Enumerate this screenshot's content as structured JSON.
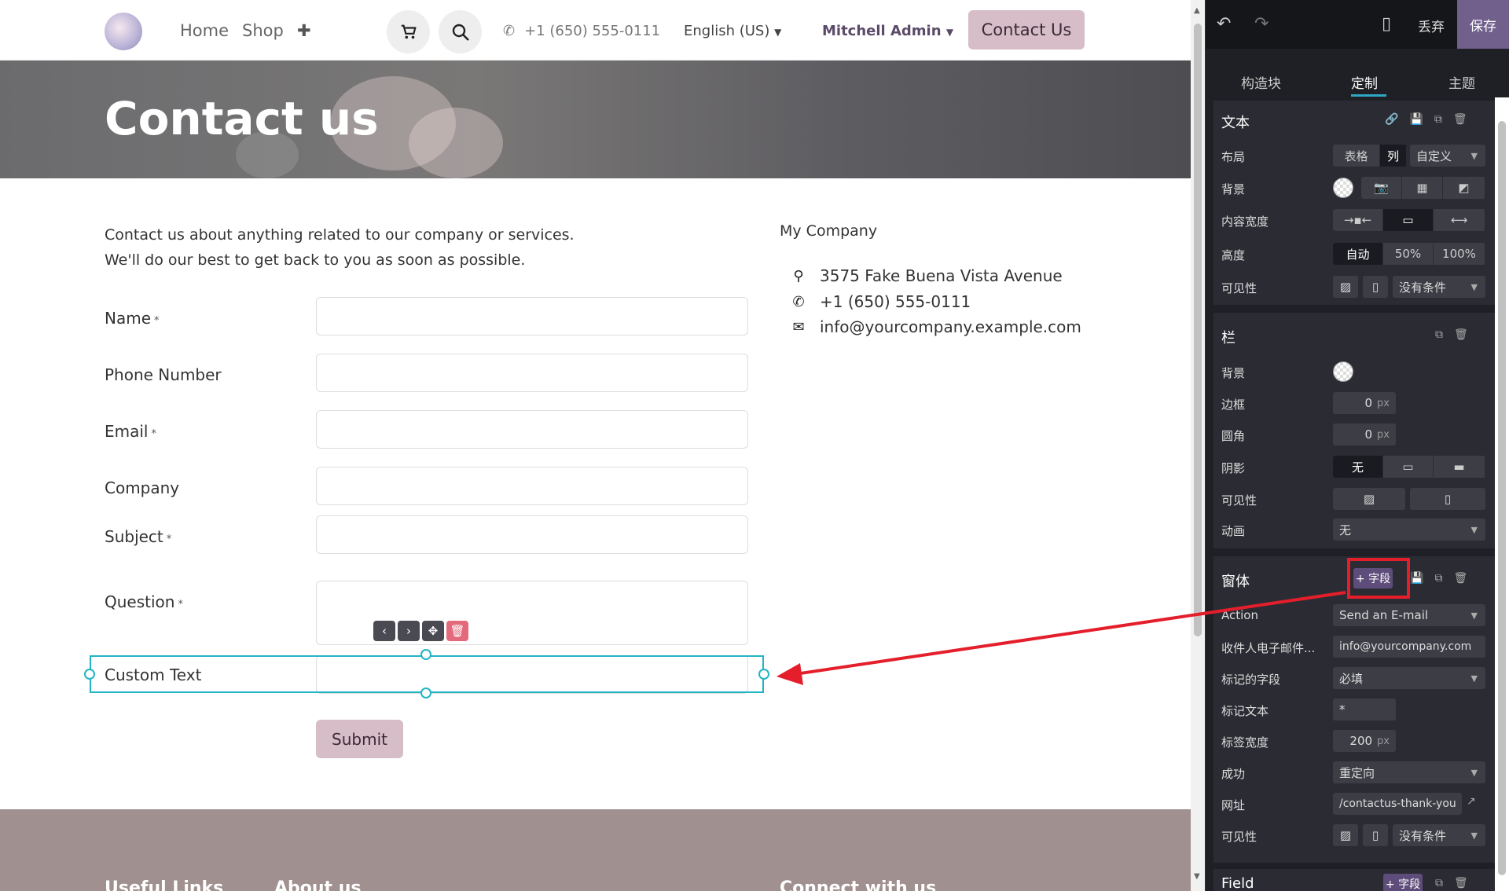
{
  "nav": {
    "home": "Home",
    "shop": "Shop",
    "plus": "✚",
    "phone": "+1 (650) 555-0111",
    "language": "English (US)",
    "admin": "Mitchell Admin",
    "contact_us": "Contact Us"
  },
  "banner": {
    "title": "Contact us"
  },
  "intro": {
    "line1": "Contact us about anything related to our company or services.",
    "line2": "We'll do our best to get back to you as soon as possible."
  },
  "company": {
    "name": "My Company",
    "address": "3575 Fake Buena Vista Avenue",
    "phone": "+1 (650) 555-0111",
    "email": "info@yourcompany.example.com"
  },
  "form": {
    "name": "Name",
    "phone": "Phone Number",
    "email": "Email",
    "company": "Company",
    "subject": "Subject",
    "question": "Question",
    "custom": "Custom Text",
    "required_mark": "*",
    "submit": "Submit"
  },
  "footer": {
    "useful_links": "Useful Links",
    "about": "About us",
    "connect": "Connect with us"
  },
  "panel": {
    "discard": "丢弃",
    "save": "保存",
    "tabs": [
      "构造块",
      "定制",
      "主题"
    ],
    "text_section": {
      "title": "文本",
      "layout": "布局",
      "layout_opts": [
        "表格",
        "列",
        "自定义"
      ],
      "background": "背景",
      "content_width": "内容宽度",
      "height": "高度",
      "height_opts": [
        "自动",
        "50%",
        "100%"
      ],
      "visibility": "可见性",
      "no_condition": "没有条件"
    },
    "column_section": {
      "title": "栏",
      "background": "背景",
      "border": "边框",
      "border_val": "0",
      "radius": "圆角",
      "radius_val": "0",
      "unit": "px",
      "shadow": "阴影",
      "shadow_none": "无",
      "visibility": "可见性",
      "animation": "动画",
      "animation_val": "无"
    },
    "form_section": {
      "title": "窗体",
      "add_field": "+ 字段",
      "action": "Action",
      "action_val": "Send an E-mail",
      "recipient": "收件人电子邮件...",
      "recipient_val": "info@yourcompany.com",
      "marked": "标记的字段",
      "marked_val": "必填",
      "mark_text": "标记文本",
      "mark_text_val": "*",
      "label_width": "标签宽度",
      "label_width_val": "200",
      "success": "成功",
      "success_val": "重定向",
      "url": "网址",
      "url_val": "/contactus-thank-you",
      "visibility": "可见性",
      "no_condition": "没有条件"
    },
    "field_section": {
      "title": "Field",
      "add_field": "+ 字段"
    }
  }
}
